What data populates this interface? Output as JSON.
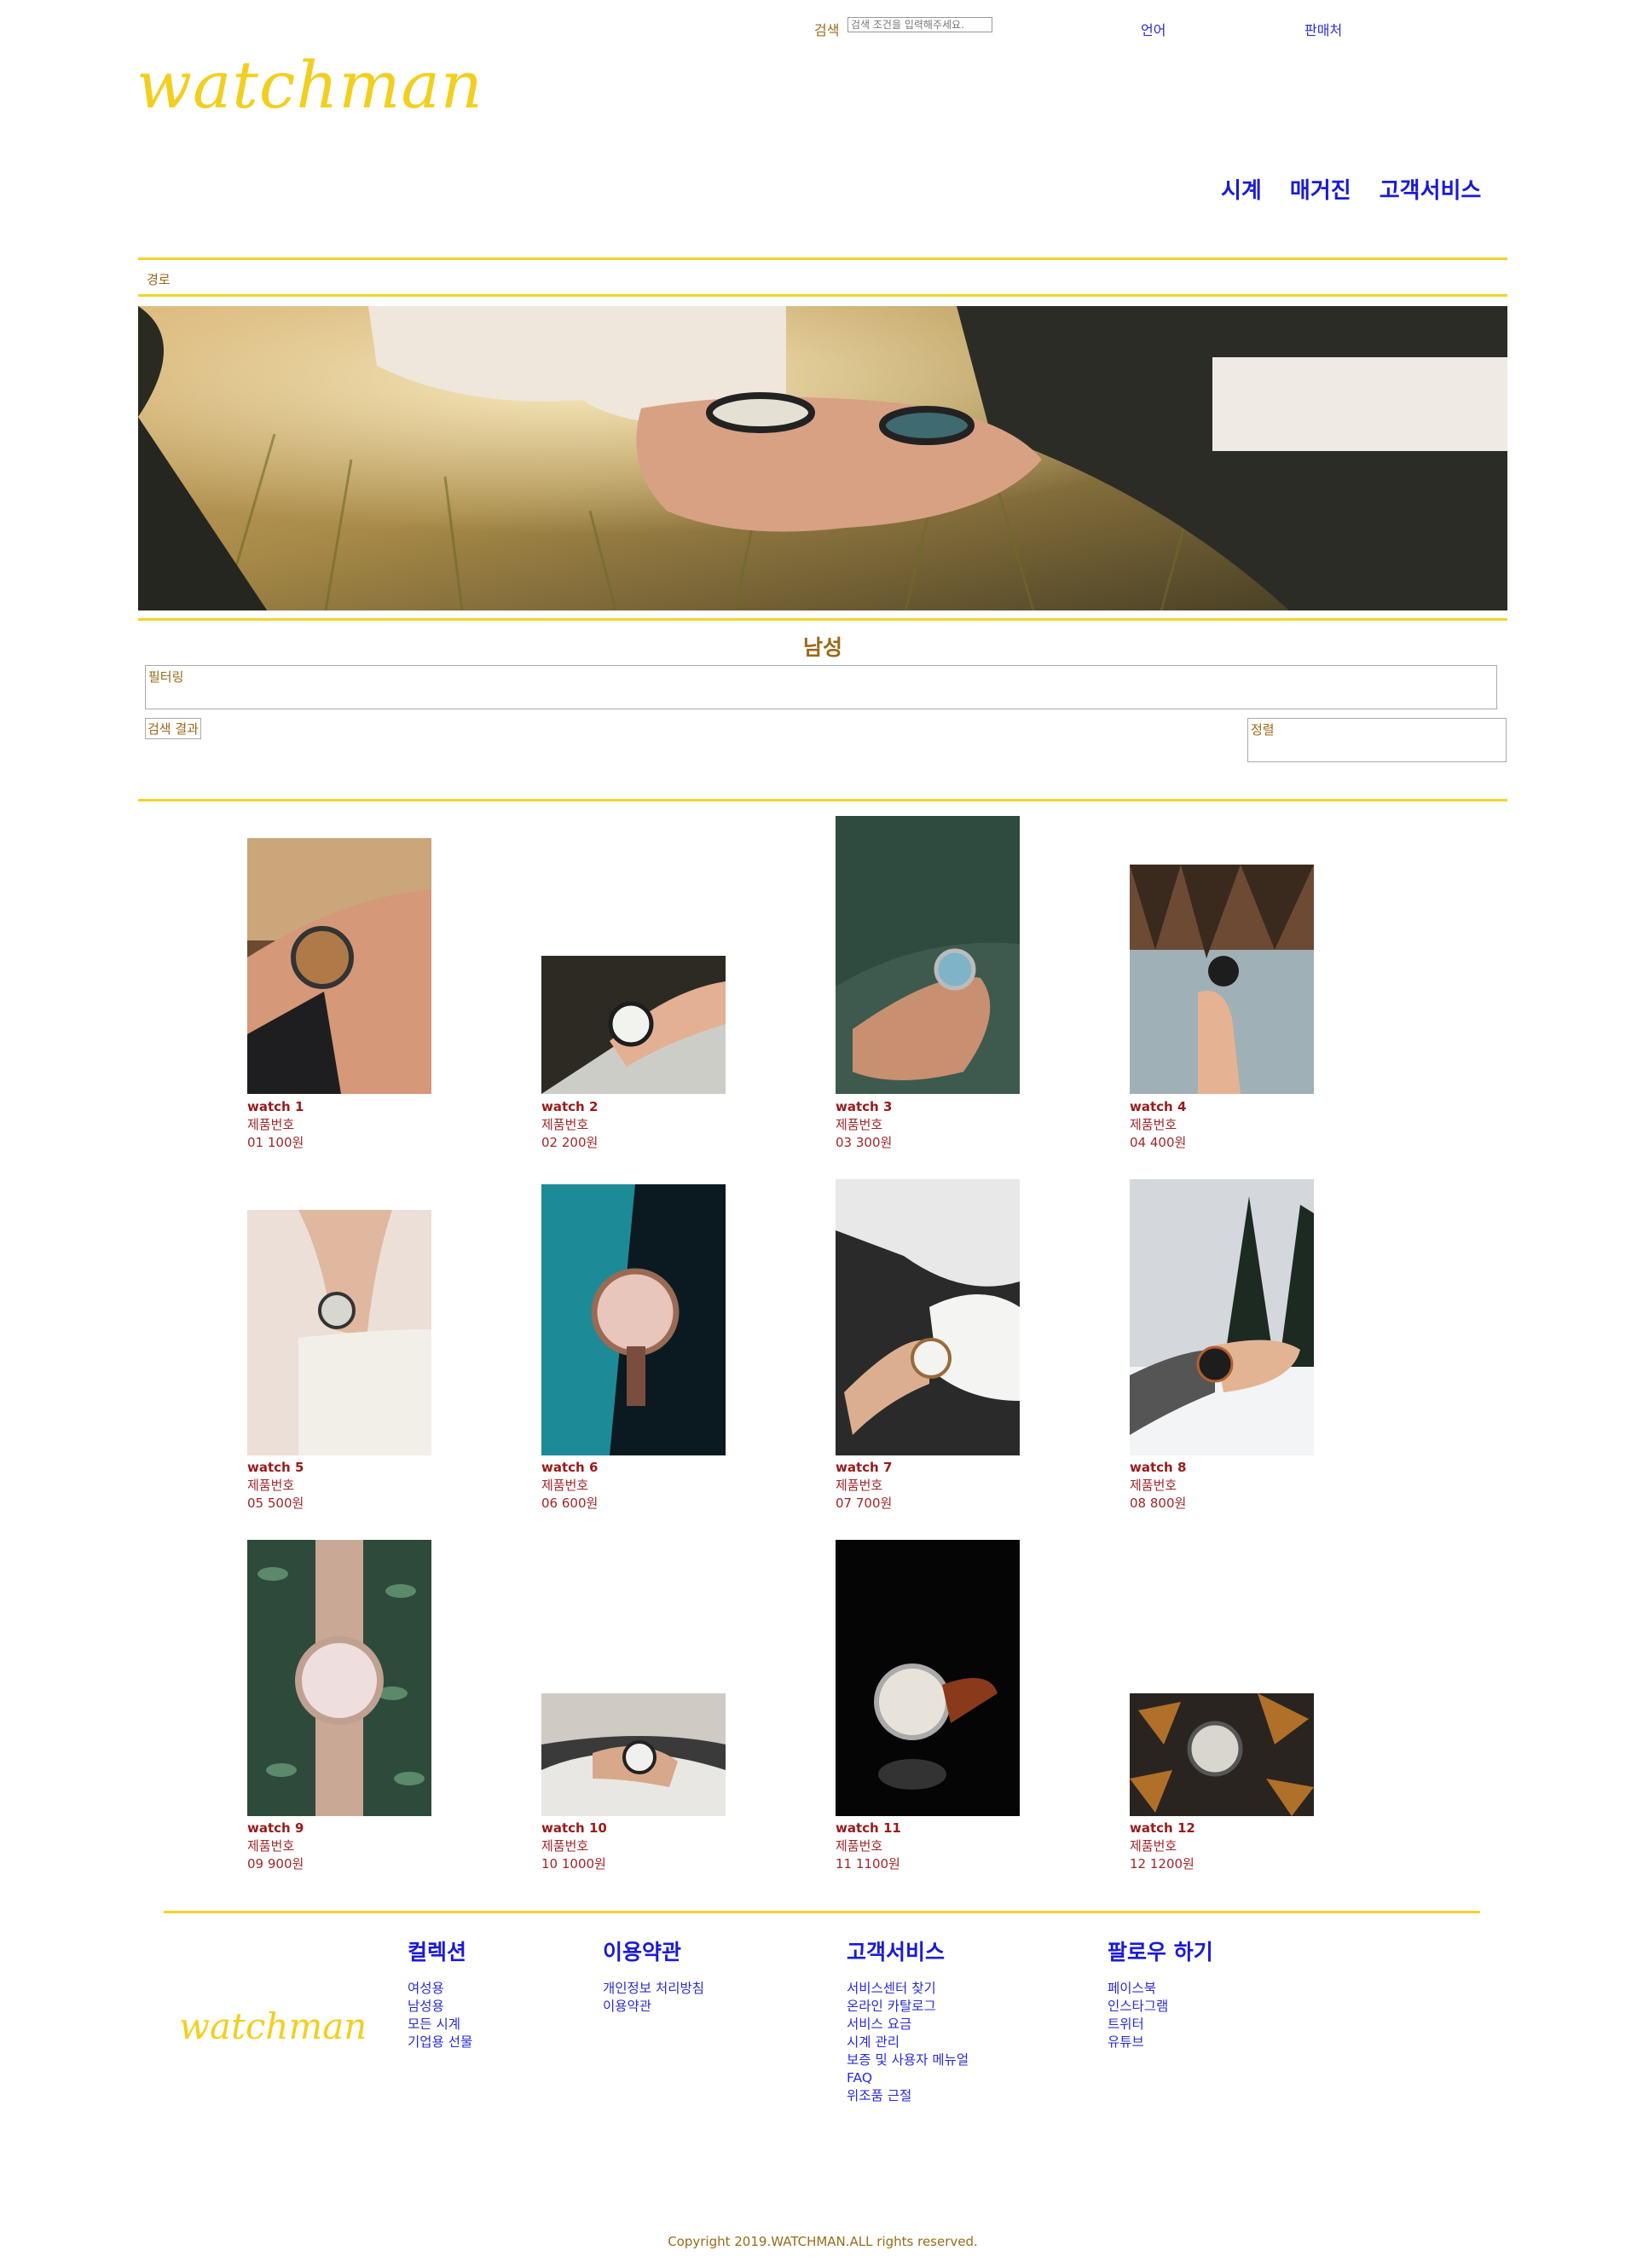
{
  "header": {
    "search_label": "검색",
    "search_placeholder": "검색 조건을 입력해주세요.",
    "language_label": "언어",
    "store_label": "판매처",
    "logo_text": "watchman",
    "nav": [
      "시계",
      "매거진",
      "고객서비스"
    ]
  },
  "breadcrumb": "경로",
  "page_title": "남성",
  "filter_label": "필터링",
  "result_label": "검색 결과",
  "sort_label": "정렬",
  "products": [
    {
      "name": "watch 1",
      "code_label": "제품번호",
      "price": "01 100원"
    },
    {
      "name": "watch 2",
      "code_label": "제품번호",
      "price": "02 200원"
    },
    {
      "name": "watch 3",
      "code_label": "제품번호",
      "price": "03 300원"
    },
    {
      "name": "watch 4",
      "code_label": "제품번호",
      "price": "04 400원"
    },
    {
      "name": "watch 5",
      "code_label": "제품번호",
      "price": "05 500원"
    },
    {
      "name": "watch 6",
      "code_label": "제품번호",
      "price": "06 600원"
    },
    {
      "name": "watch 7",
      "code_label": "제품번호",
      "price": "07 700원"
    },
    {
      "name": "watch 8",
      "code_label": "제품번호",
      "price": "08 800원"
    },
    {
      "name": "watch 9",
      "code_label": "제품번호",
      "price": "09 900원"
    },
    {
      "name": "watch 10",
      "code_label": "제품번호",
      "price": "10 1000원"
    },
    {
      "name": "watch 11",
      "code_label": "제품번호",
      "price": "11 1100원"
    },
    {
      "name": "watch 12",
      "code_label": "제품번호",
      "price": "12 1200원"
    }
  ],
  "footer": {
    "logo_text": "watchman",
    "columns": [
      {
        "title": "컬렉션",
        "links": [
          "여성용",
          "남성용",
          "모든 시계",
          "기업용 선물"
        ]
      },
      {
        "title": "이용약관",
        "links": [
          "개인정보 처리방침",
          "이용약관"
        ]
      },
      {
        "title": "고객서비스",
        "links": [
          "서비스센터 찾기",
          "온라인 카탈로그",
          "서비스 요금",
          "시계 관리",
          "보증 및 사용자 메뉴얼",
          "FAQ",
          "위조품 근절"
        ]
      },
      {
        "title": "팔로우 하기",
        "links": [
          "페이스북",
          "인스타그램",
          "트위터",
          "유튜브"
        ]
      }
    ],
    "copyright": "Copyright 2019.WATCHMAN.ALL rights reserved."
  },
  "colors": {
    "accent_gold": "#f5d22a",
    "link_blue": "#1a1ad6",
    "text_brown": "#9a6a1a",
    "product_red": "#9a1a1a"
  }
}
